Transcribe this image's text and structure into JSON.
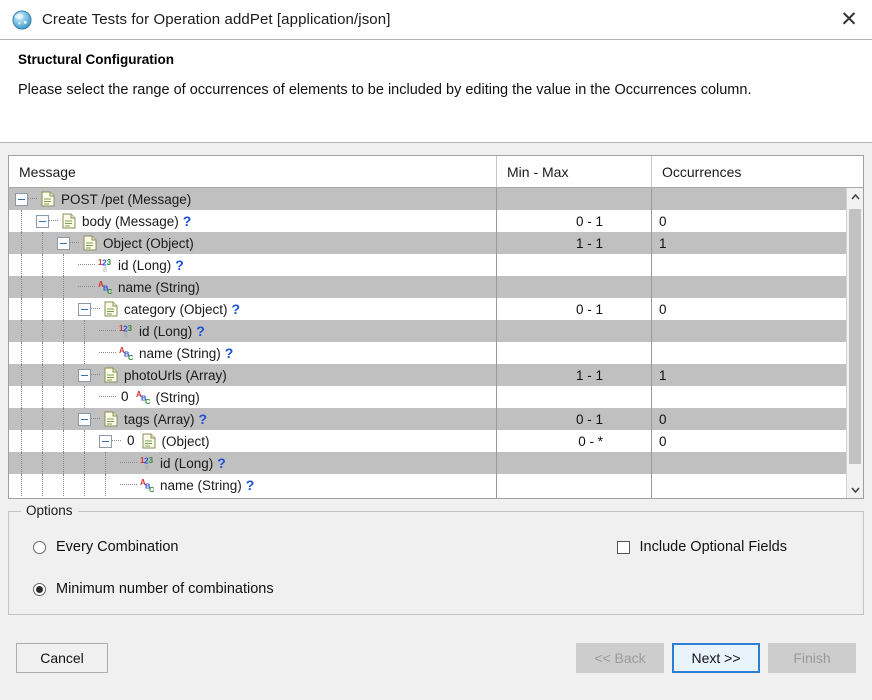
{
  "window": {
    "title": "Create Tests for Operation addPet [application/json]",
    "app_icon": "globe-icon",
    "close_label": "✕"
  },
  "header": {
    "title": "Structural Configuration",
    "description": "Please select the range of occurrences of elements to be included by editing the value in the Occurrences column."
  },
  "table": {
    "columns": [
      "Message",
      "Min - Max",
      "Occurrences"
    ],
    "rows": [
      {
        "label": "POST /pet (Message)",
        "depth": 0,
        "icon": "document-icon",
        "toggle": "expanded",
        "optional": false,
        "index": null,
        "min_max": "",
        "occurrences": ""
      },
      {
        "label": "body (Message)",
        "depth": 1,
        "icon": "document-icon",
        "toggle": "expanded",
        "optional": true,
        "index": null,
        "min_max": "0 - 1",
        "occurrences": "0"
      },
      {
        "label": "Object (Object)",
        "depth": 2,
        "icon": "document-icon",
        "toggle": "expanded",
        "optional": false,
        "index": null,
        "min_max": "1 - 1",
        "occurrences": "1"
      },
      {
        "label": "id (Long)",
        "depth": 3,
        "icon": "number-icon",
        "toggle": "leaf",
        "optional": true,
        "index": null,
        "min_max": "",
        "occurrences": ""
      },
      {
        "label": "name (String)",
        "depth": 3,
        "icon": "string-icon",
        "toggle": "leaf",
        "optional": false,
        "index": null,
        "min_max": "",
        "occurrences": ""
      },
      {
        "label": "category (Object)",
        "depth": 3,
        "icon": "document-icon",
        "toggle": "expanded",
        "optional": true,
        "index": null,
        "min_max": "0 - 1",
        "occurrences": "0"
      },
      {
        "label": "id (Long)",
        "depth": 4,
        "icon": "number-icon",
        "toggle": "leaf",
        "optional": true,
        "index": null,
        "min_max": "",
        "occurrences": ""
      },
      {
        "label": "name (String)",
        "depth": 4,
        "icon": "string-icon",
        "toggle": "leaf",
        "optional": true,
        "index": null,
        "min_max": "",
        "occurrences": ""
      },
      {
        "label": "photoUrls (Array)",
        "depth": 3,
        "icon": "document-icon",
        "toggle": "expanded",
        "optional": false,
        "index": null,
        "min_max": "1 - 1",
        "occurrences": "1"
      },
      {
        "label": "(String)",
        "depth": 4,
        "icon": "string-icon",
        "toggle": "leaf",
        "optional": false,
        "index": "0",
        "min_max": "",
        "occurrences": ""
      },
      {
        "label": "tags (Array)",
        "depth": 3,
        "icon": "document-icon",
        "toggle": "expanded",
        "optional": true,
        "index": null,
        "min_max": "0 - 1",
        "occurrences": "0"
      },
      {
        "label": "(Object)",
        "depth": 4,
        "icon": "document-icon",
        "toggle": "expanded",
        "optional": false,
        "index": "0",
        "min_max": "0 - *",
        "occurrences": "0"
      },
      {
        "label": "id (Long)",
        "depth": 5,
        "icon": "number-icon",
        "toggle": "leaf",
        "optional": true,
        "index": null,
        "min_max": "",
        "occurrences": ""
      },
      {
        "label": "name (String)",
        "depth": 5,
        "icon": "string-icon",
        "toggle": "leaf",
        "optional": true,
        "index": null,
        "min_max": "",
        "occurrences": ""
      }
    ],
    "optional_marker": "?",
    "scroll_up_icon": "chevron-up-icon",
    "scroll_down_icon": "chevron-down-icon"
  },
  "options": {
    "legend": "Options",
    "radio_every_combination": {
      "label": "Every Combination",
      "selected": false
    },
    "radio_minimum_combinations": {
      "label": "Minimum number of combinations",
      "selected": true
    },
    "checkbox_include_optional": {
      "label": "Include Optional Fields",
      "checked": false
    }
  },
  "buttons": {
    "cancel": {
      "label": "Cancel",
      "disabled": false
    },
    "back": {
      "label": "<< Back",
      "disabled": true
    },
    "next": {
      "label": "Next >>",
      "disabled": false,
      "focused": true
    },
    "finish": {
      "label": "Finish",
      "disabled": true
    }
  },
  "colors": {
    "row_alt": "#c0c0c0",
    "accent_focus": "#2d7dd2",
    "optional_marker": "#1a4fd6"
  }
}
